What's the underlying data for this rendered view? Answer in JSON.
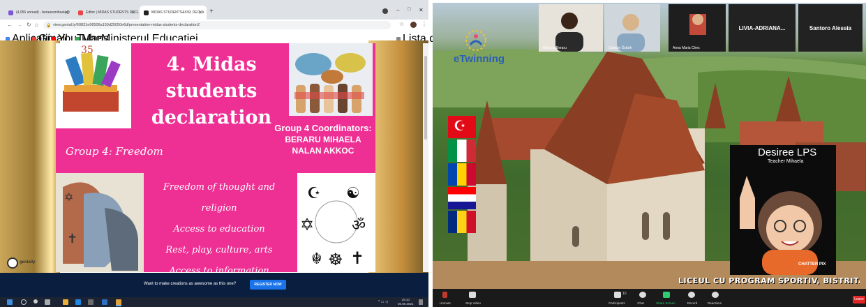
{
  "left": {
    "tabs": [
      {
        "label": "(4,056 unread) - beraarumihaela@",
        "icon_color": "#7b57d6"
      },
      {
        "label": "Editor | MIDAS STUDENTS DECL",
        "icon_color": "#e8474a"
      },
      {
        "label": "MIDAS STUDENTS&#39; DECLA",
        "icon_color": "#222222"
      }
    ],
    "url": "view.genial.ly/60831e96506a150d25050e6d/presentation-midas-students-declaration2",
    "bookmarks": [
      {
        "label": "Aplicații",
        "icon_color": "#4285f4"
      },
      {
        "label": "Gmail",
        "icon_color": "#ea4335"
      },
      {
        "label": "YouTube",
        "icon_color": "#ff0000"
      },
      {
        "label": "Maps",
        "icon_color": "#34a853"
      },
      {
        "label": "Ministerul Educației",
        "icon_color": "#555555"
      }
    ],
    "reading_list": "Lista de lectură",
    "slide": {
      "title_line1": "4. Midas",
      "title_line2": "students",
      "title_line3": "declaration",
      "group_label": "Group 4: Freedom",
      "coordinators_heading": "Group 4 Coordinators:",
      "coordinator_1": "BERARU MIHAELA",
      "coordinator_2": "NALAN AKKOC",
      "freedoms": [
        "Freedom of thought and religion",
        "Access to education",
        "Rest, play, culture, arts",
        "Access to information"
      ],
      "genially_label": "genially"
    },
    "banner_text": "Want to make creations as awesome as this one?",
    "register_label": "REGISTER NOW",
    "tray_time": "19:10",
    "tray_date": "30.05.2021"
  },
  "right": {
    "participants": [
      {
        "name": "Mihaela Beraru",
        "type": "video"
      },
      {
        "name": "Gülsüm Öztürk",
        "type": "video"
      },
      {
        "name": "Anna Maria Clres",
        "type": "video"
      },
      {
        "name": "LIVIA-ADRIANA...",
        "type": "name"
      },
      {
        "name": "Santoro Alessia",
        "type": "name"
      }
    ],
    "etwinning_label": "eTwinning",
    "flags": [
      {
        "country": "Turkey",
        "colors": [
          "#e30a17"
        ]
      },
      {
        "country": "Italy",
        "colors": [
          "#009246",
          "#ffffff",
          "#ce2b37"
        ]
      },
      {
        "country": "Moldova",
        "colors": [
          "#0046ae",
          "#ffd200",
          "#cc092f"
        ]
      },
      {
        "country": "Croatia",
        "colors": [
          "#ff0000",
          "#ffffff",
          "#171796"
        ]
      },
      {
        "country": "Romania",
        "colors": [
          "#002b7f",
          "#fcd116",
          "#ce1126"
        ]
      }
    ],
    "presenter": {
      "name": "Desiree LPS",
      "subtitle": "Teacher Mihaela",
      "watermark": "CHATTER PIX"
    },
    "school_caption": "LICEUL CU PROGRAM SPORTIV, BISTRITA, ROMANIA",
    "controls": [
      {
        "label": "Unmute",
        "icon_color": "#c0392b"
      },
      {
        "label": "Stop Video",
        "icon_color": "#dddddd"
      },
      {
        "label": "Participants",
        "icon_color": "#dddddd",
        "count": "10"
      },
      {
        "label": "Chat",
        "icon_color": "#dddddd"
      },
      {
        "label": "Share Screen",
        "icon_color": "#2ecc71"
      },
      {
        "label": "Record",
        "icon_color": "#dddddd"
      },
      {
        "label": "Reactions",
        "icon_color": "#dddddd"
      }
    ],
    "leave_label": "Leave",
    "leave_color": "#e02828"
  }
}
